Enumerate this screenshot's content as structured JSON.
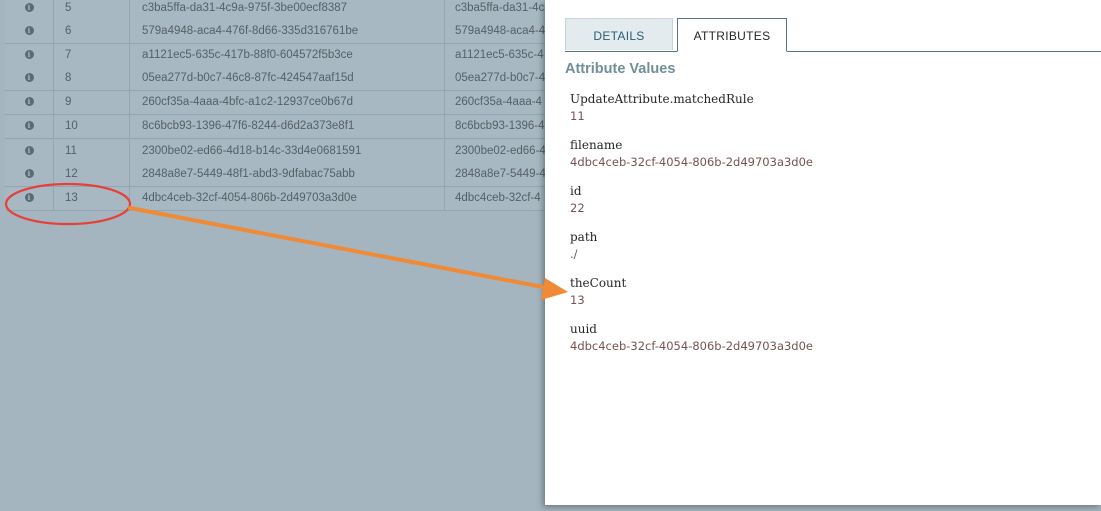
{
  "table": {
    "rows": [
      {
        "position": "5",
        "uuid": "c3ba5ffa-da31-4c9a-975f-3be00ecf8387",
        "uuid_partial": "c3ba5ffa-da31-4c"
      },
      {
        "position": "6",
        "uuid": "579a4948-aca4-476f-8d66-335d316761be",
        "uuid_partial": "579a4948-aca4-4"
      },
      {
        "position": "7",
        "uuid": "a1121ec5-635c-417b-88f0-604572f5b3ce",
        "uuid_partial": "a1121ec5-635c-4"
      },
      {
        "position": "8",
        "uuid": "05ea277d-b0c7-46c8-87fc-424547aaf15d",
        "uuid_partial": "05ea277d-b0c7-4"
      },
      {
        "position": "9",
        "uuid": "260cf35a-4aaa-4bfc-a1c2-12937ce0b67d",
        "uuid_partial": "260cf35a-4aaa-4"
      },
      {
        "position": "10",
        "uuid": "8c6bcb93-1396-47f6-8244-d6d2a373e8f1",
        "uuid_partial": "8c6bcb93-1396-4"
      },
      {
        "position": "11",
        "uuid": "2300be02-ed66-4d18-b14c-33d4e0681591",
        "uuid_partial": "2300be02-ed66-4"
      },
      {
        "position": "12",
        "uuid": "2848a8e7-5449-48f1-abd3-9dfabac75abb",
        "uuid_partial": "2848a8e7-5449-4"
      },
      {
        "position": "13",
        "uuid": "4dbc4ceb-32cf-4054-806b-2d49703a3d0e",
        "uuid_partial": "4dbc4ceb-32cf-4"
      }
    ],
    "row_icon": "info-icon"
  },
  "dialog": {
    "tabs": [
      {
        "label": "DETAILS",
        "active": false
      },
      {
        "label": "ATTRIBUTES",
        "active": true
      }
    ],
    "section_title": "Attribute Values",
    "attributes": [
      {
        "name": "UpdateAttribute.matchedRule",
        "value": "11"
      },
      {
        "name": "filename",
        "value": "4dbc4ceb-32cf-4054-806b-2d49703a3d0e"
      },
      {
        "name": "id",
        "value": "22"
      },
      {
        "name": "path",
        "value": "./"
      },
      {
        "name": "theCount",
        "value": "13"
      },
      {
        "name": "uuid",
        "value": "4dbc4ceb-32cf-4054-806b-2d49703a3d0e"
      }
    ]
  },
  "annotation": {
    "circle_color": "#e5413a",
    "arrow_color": "#f08a36"
  }
}
